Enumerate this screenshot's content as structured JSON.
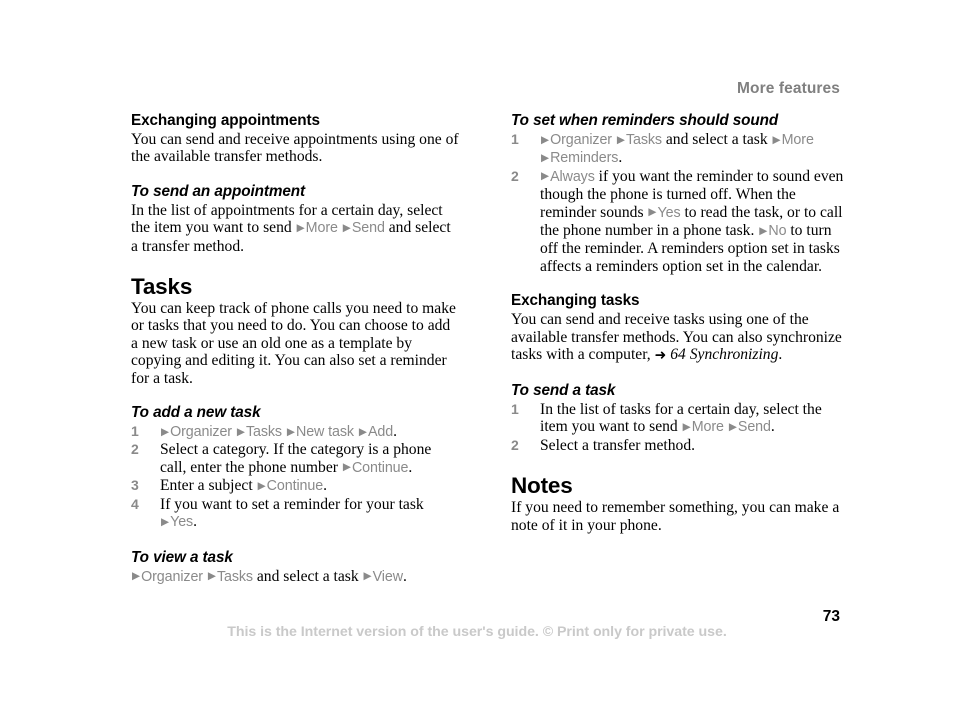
{
  "header": {
    "running_title": "More features"
  },
  "footer": {
    "notice": "This is the Internet version of the user's guide. © Print only for private use.",
    "page_number": "73"
  },
  "tokens": {
    "arrow": "▶",
    "xref_arrow": "➜"
  },
  "left_column": {
    "exchanging_appointments": {
      "heading": "Exchanging appointments",
      "body_line1": "You can send and receive appointments using one",
      "body_line2": "of the available transfer methods."
    },
    "to_send_an_appointment": {
      "heading": "To send an appointment",
      "line1": "In the list of appointments for a certain day, select",
      "line2_pre": "the item you want to send",
      "ui_more": "More",
      "ui_send": "Send",
      "line2_post": "and select",
      "line3": "a transfer method."
    },
    "tasks": {
      "heading": "Tasks",
      "body_line1": "You can keep track of phone calls you need to",
      "body_line2": "make or tasks that you need to do. You can choose",
      "body_line3": "to add a new task or use an old one as a template by",
      "body_line4": "copying and editing it. You can also set a reminder",
      "body_line5": "for a task."
    },
    "to_add_a_new_task": {
      "heading": "To add a new task",
      "steps": [
        {
          "num": "1",
          "ui_organizer": "Organizer",
          "ui_tasks": "Tasks",
          "ui_new_task": "New task",
          "ui_add": "Add",
          "period": "."
        },
        {
          "num": "2",
          "line1": "Select a category. If the category is a phone",
          "line2_pre": "call, enter the phone number",
          "ui_continue": "Continue",
          "period": "."
        },
        {
          "num": "3",
          "line1_pre": "Enter a subject",
          "ui_continue": "Continue",
          "period": "."
        },
        {
          "num": "4",
          "line1_pre": "If you want to set a reminder for your task",
          "ui_yes": "Yes",
          "period": "."
        }
      ]
    },
    "to_view_a_task": {
      "heading": "To view a task",
      "ui_organizer": "Organizer",
      "ui_tasks": "Tasks",
      "mid_text": "and select a task",
      "ui_view": "View",
      "period": "."
    }
  },
  "right_column": {
    "to_set_when_reminders_should_sound": {
      "heading": "To set when reminders should sound",
      "steps": [
        {
          "num": "1",
          "ui_organizer": "Organizer",
          "ui_tasks": "Tasks",
          "mid_text": "and select a task",
          "ui_more": "More",
          "ui_reminders": "Reminders",
          "period": "."
        },
        {
          "num": "2",
          "ui_always": "Always",
          "line1_post": "if you want the reminder to sound",
          "line2": "even though the phone is turned off. When the",
          "line3_pre": "reminder sounds",
          "ui_yes": "Yes",
          "line3_post": "to read the task, or to",
          "line4_pre": "call the phone number in a phone task.",
          "ui_no": "No",
          "line4_post": "to",
          "line5": "turn off the reminder. A reminders option set",
          "line6": "in tasks affects a reminders option set in the",
          "line7": "calendar."
        }
      ]
    },
    "exchanging_tasks": {
      "heading": "Exchanging tasks",
      "body_line1": "You can send and receive tasks using one of the",
      "body_line2": "available transfer methods. You can also synchronize",
      "body_line3_pre": "tasks with a computer,",
      "xref_label": "64 Synchronizing",
      "period": "."
    },
    "to_send_a_task": {
      "heading": "To send a task",
      "steps": [
        {
          "num": "1",
          "line1": "In the list of tasks for a certain day, select the",
          "line2_pre": "item you want to send",
          "ui_more": "More",
          "ui_send": "Send",
          "period": "."
        },
        {
          "num": "2",
          "line1": "Select a transfer method."
        }
      ]
    },
    "notes": {
      "heading": "Notes",
      "body_line1": "If you need to remember something, you can make",
      "body_line2": "a note of it in your phone."
    }
  }
}
